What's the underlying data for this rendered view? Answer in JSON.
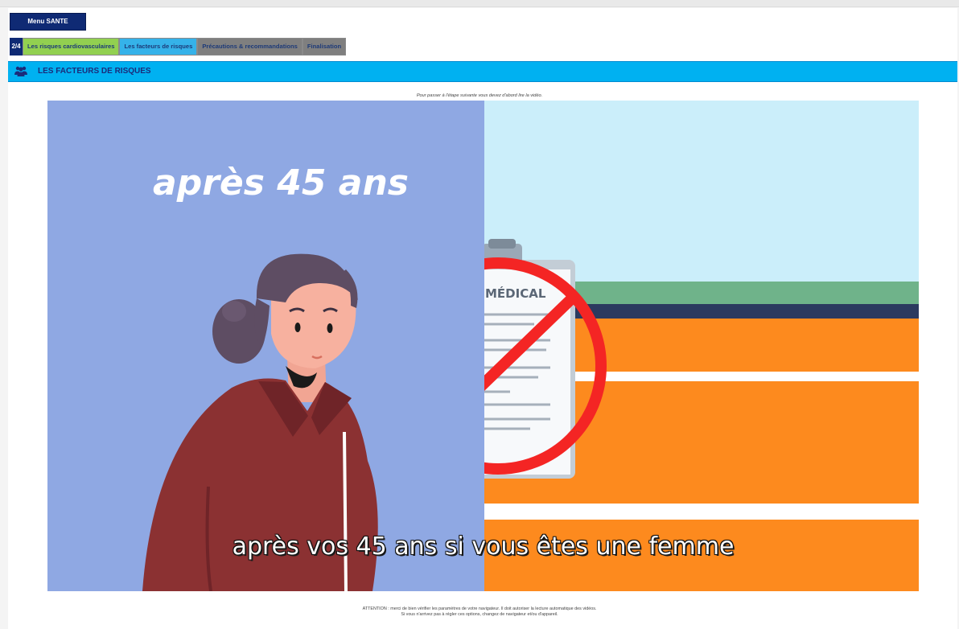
{
  "menu": {
    "label": "Menu SANTE"
  },
  "progress": {
    "step": "2/4"
  },
  "tabs": [
    {
      "label": "Les risques cardiovasculaires",
      "state": "done"
    },
    {
      "label": "Les facteurs de risques",
      "state": "active"
    },
    {
      "label": "Précautions & recommandations",
      "state": "todo"
    },
    {
      "label": "Finalisation",
      "state": "todo"
    }
  ],
  "section": {
    "title": "LES FACTEURS DE RISQUES",
    "icon": "group-icon"
  },
  "notice_top": "Pour passer à l'étape suivante vous devez d'abord lire la vidéo.",
  "video": {
    "heading": "après 45 ans",
    "clipboard_label": "MÉDICAL",
    "subtitle": "après vos 45 ans si vous êtes une femme"
  },
  "notice_bottom": {
    "line1": "ATTENTION : merci de bien vérifier les paramètres de votre navigateur. Il doit autoriser la lecture automatique des vidéos.",
    "line2": "Si vous n'arrivez pas à régler ces options, changez de navigateur et/ou d'appareil."
  },
  "colors": {
    "navy": "#0f2a74",
    "tab_done": "#92d050",
    "tab_active": "#35b2e9",
    "tab_todo": "#7f7f7f",
    "section_bar": "#00b1f1",
    "video_left_bg": "#8fa8e3",
    "video_right_bg": "#cbeefa",
    "orange": "#fd8a1e"
  }
}
